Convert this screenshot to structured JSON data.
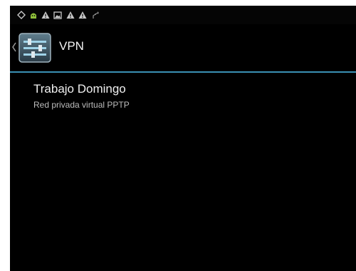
{
  "status_bar": {
    "icons": [
      "signal-ring-icon",
      "android-debug-icon",
      "warning-icon",
      "image-icon",
      "warning-icon",
      "warning-icon",
      "usb-icon"
    ],
    "icon_color": "#c8c8c8",
    "accent_color": "#8fbf3a"
  },
  "action_bar": {
    "title": "VPN",
    "icon": "vpn-settings-icon"
  },
  "vpn_list": {
    "items": [
      {
        "name": "Trabajo Domingo",
        "type": "Red privada virtual PPTP"
      }
    ]
  },
  "theme": {
    "background": "#000000",
    "divider_color": "#3a90b4",
    "text_primary": "#f0f0f0",
    "text_secondary": "#bdbdbd"
  }
}
